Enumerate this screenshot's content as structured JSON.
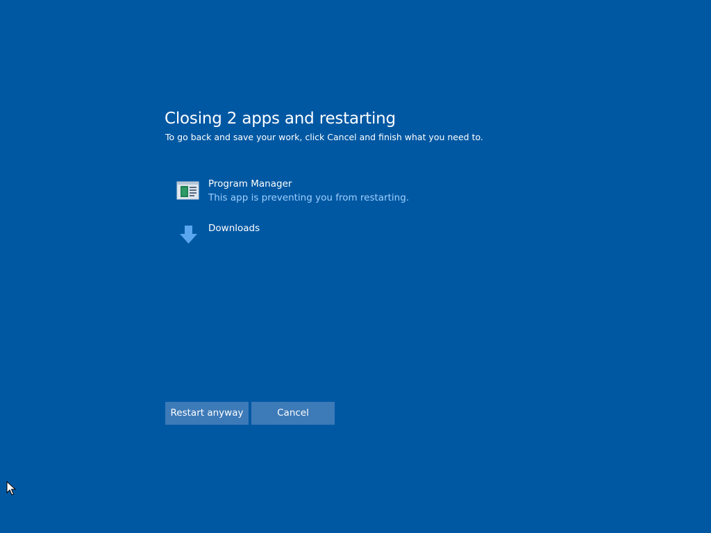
{
  "dialog": {
    "title": "Closing 2 apps and restarting",
    "subtitle": "To go back and save your work, click Cancel and finish what you need to."
  },
  "apps": [
    {
      "name": "Program Manager",
      "status": "This app is preventing you from restarting.",
      "icon": "program-manager-icon"
    },
    {
      "name": "Downloads",
      "status": "",
      "icon": "download-arrow-icon"
    }
  ],
  "buttons": {
    "restart_label": "Restart anyway",
    "cancel_label": "Cancel"
  },
  "colors": {
    "background": "#0058a3",
    "button": "#3d7ab8",
    "status_text": "#9fd0ff",
    "download_icon": "#5aa7ef"
  }
}
